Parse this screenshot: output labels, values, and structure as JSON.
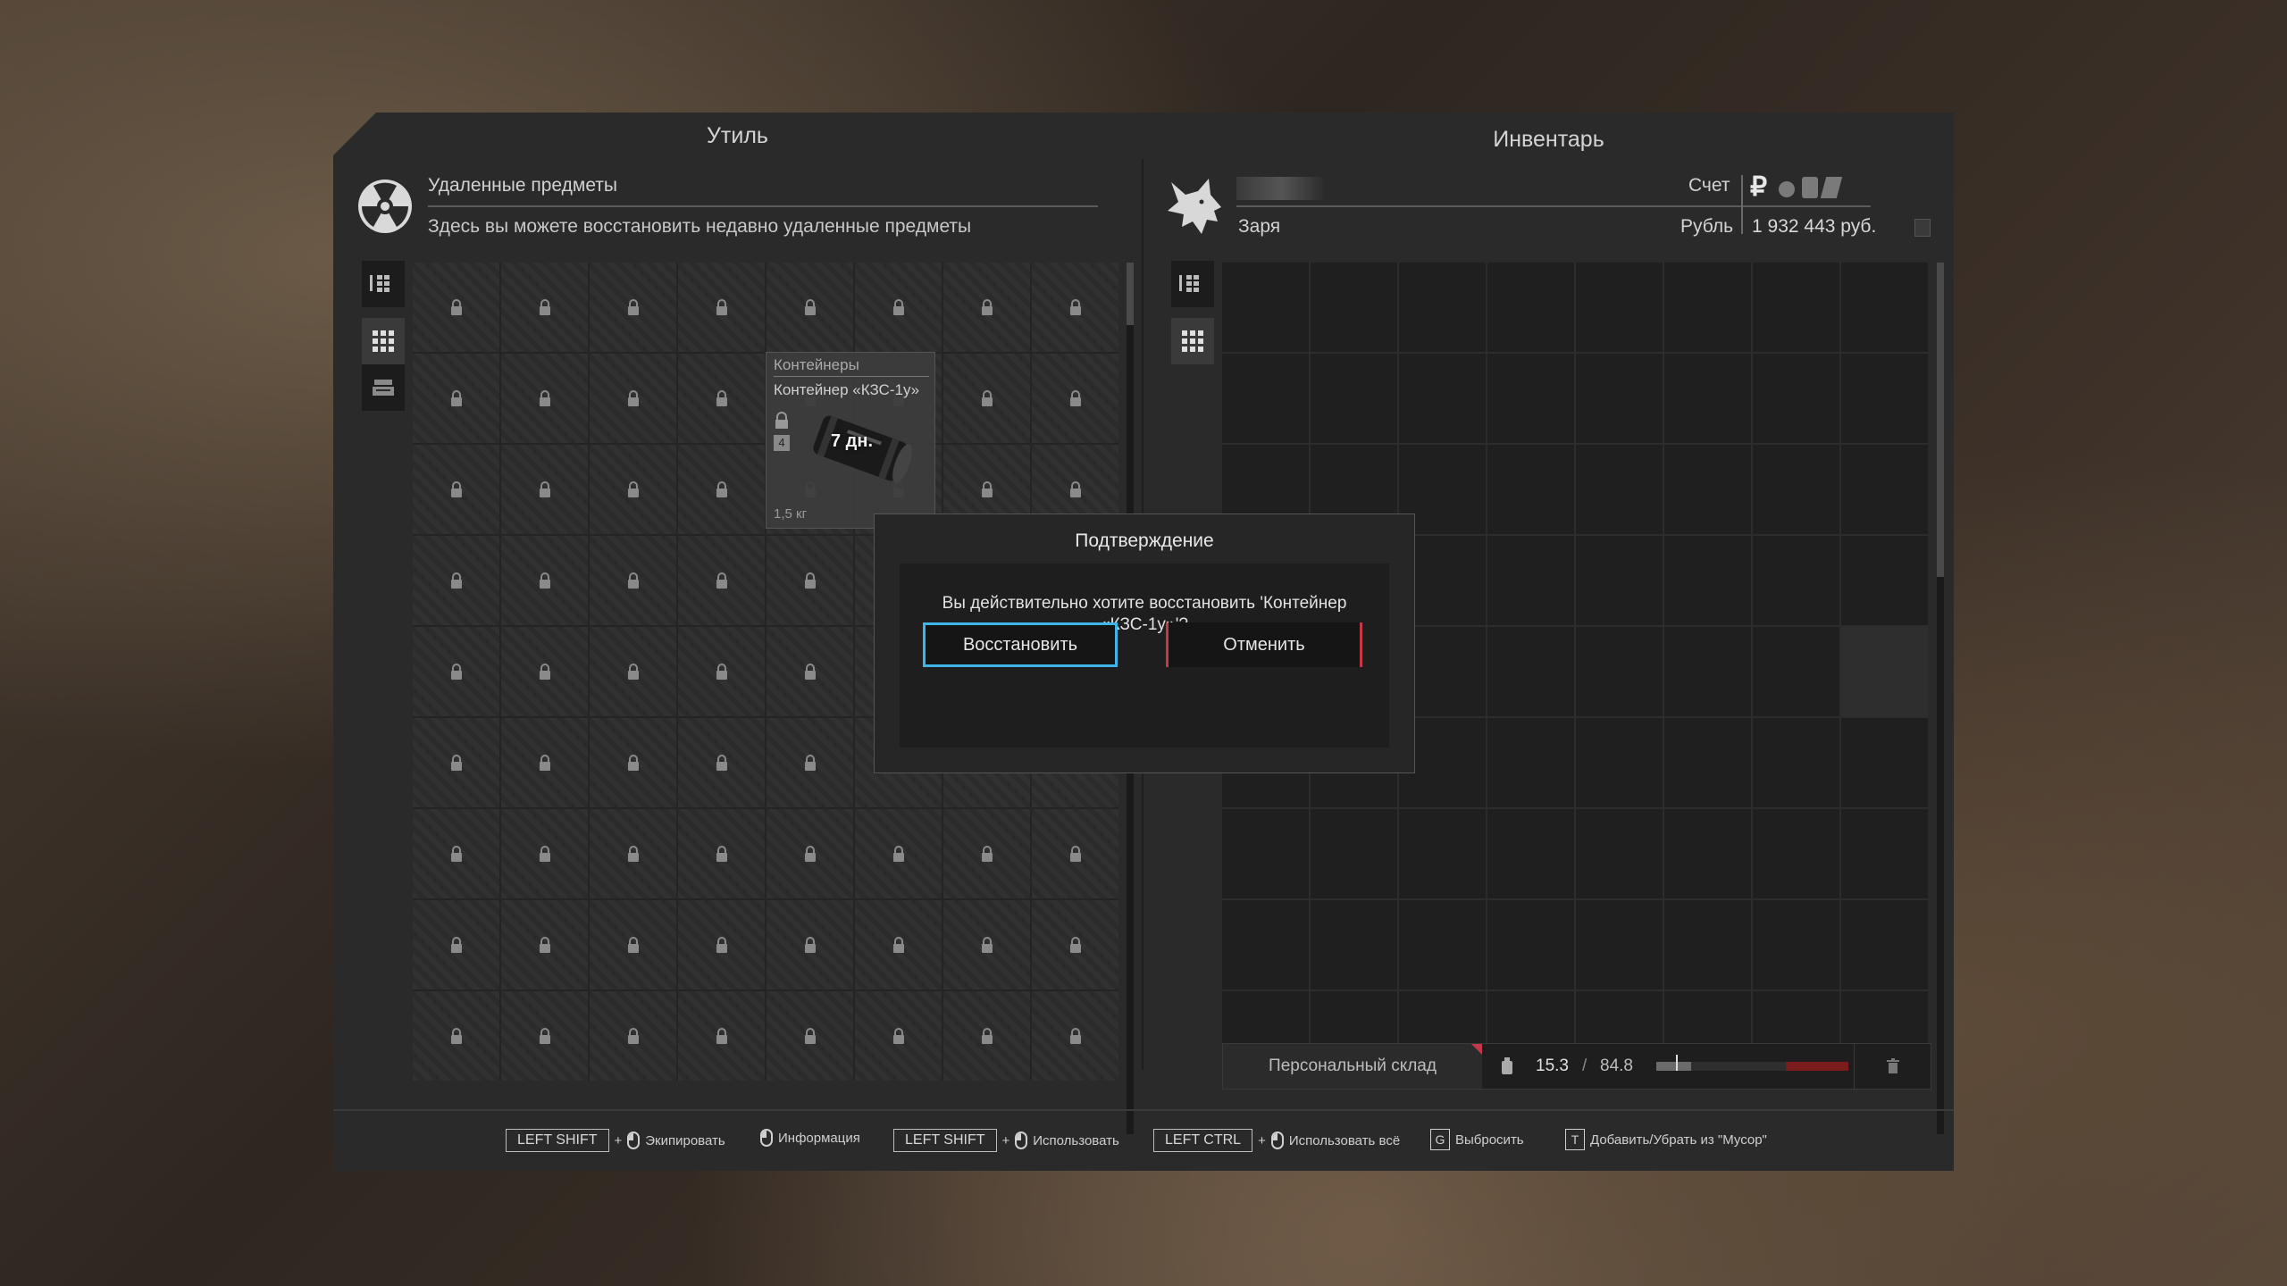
{
  "left_panel": {
    "title": "Утиль",
    "heading": "Удаленные предметы",
    "subheading": "Здесь вы можете восстановить недавно удаленные предметы",
    "item": {
      "category": "Контейнеры",
      "name": "Контейнер «КЗС-1у»",
      "timer": "7 дн.",
      "weight": "1,5 кг",
      "badge": "4"
    }
  },
  "right_panel": {
    "title": "Инвентарь",
    "faction": "Заря",
    "account_label": "Счет",
    "currency_label": "Рубль",
    "balance": "1 932 443 руб.",
    "storage_tab": "Персональный склад",
    "weight_current": "15.3",
    "weight_sep": "/",
    "weight_max": "84.8",
    "weight_fill_fraction": 0.18
  },
  "dialog": {
    "title": "Подтверждение",
    "message_line1": "Вы действительно хотите восстановить 'Контейнер",
    "message_line2": "«КЗС-1у»'?",
    "confirm_label": "Восстановить",
    "cancel_label": "Отменить"
  },
  "footer": {
    "hint1_key": "LEFT SHIFT",
    "hint1_plus": "+",
    "hint1_label": "Экипировать",
    "hint2_label": "Информация",
    "hint3_key": "LEFT SHIFT",
    "hint3_plus": "+",
    "hint3_label": "Использовать",
    "hint4_key": "LEFT CTRL",
    "hint4_plus": "+",
    "hint4_label": "Использовать всё",
    "hint5_key": "G",
    "hint5_label": "Выбросить",
    "hint6_key": "T",
    "hint6_label": "Добавить/Убрать из \"Мусор\""
  },
  "colors": {
    "accent_blue": "#3fb4e6",
    "cancel_red": "#c43a48",
    "weight_red": "#7a1c1c"
  }
}
